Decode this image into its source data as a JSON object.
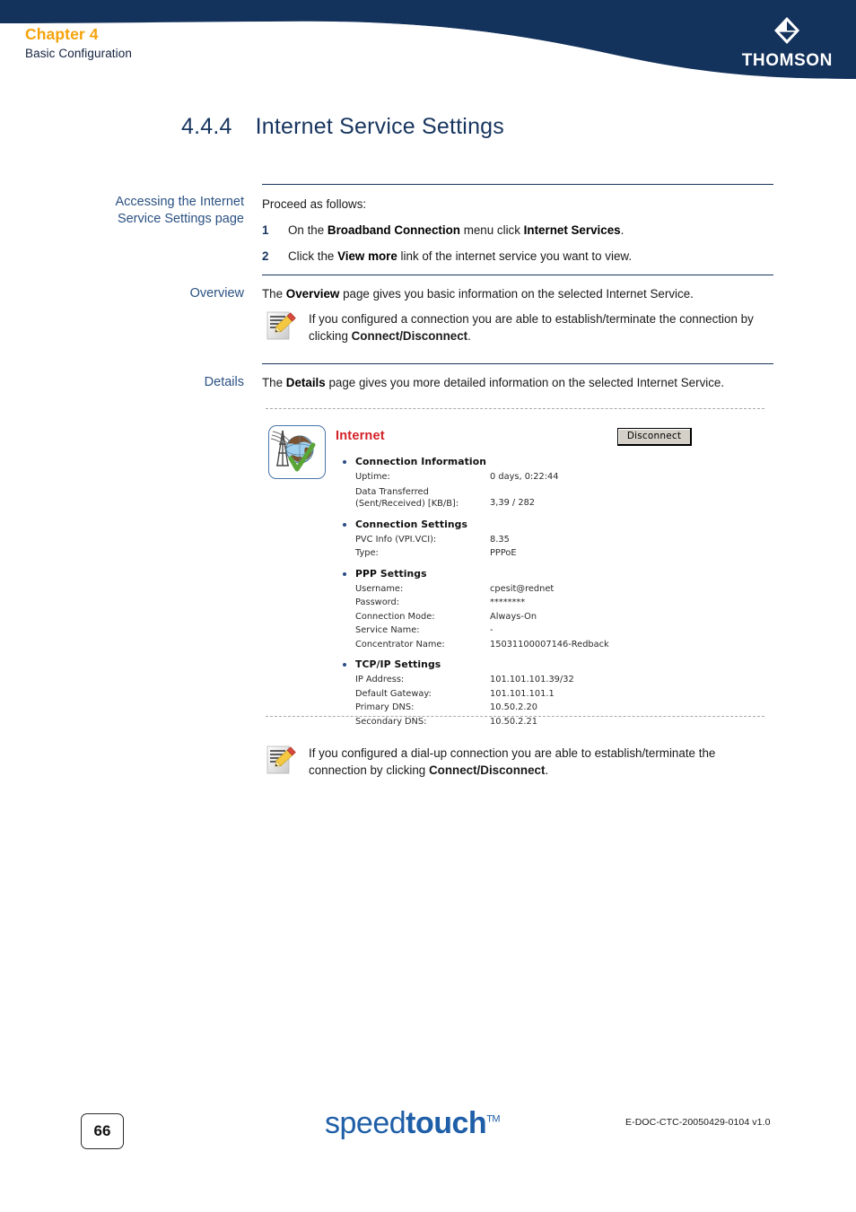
{
  "header": {
    "chapter": "Chapter 4",
    "subtitle": "Basic Configuration",
    "brand": "THOMSON",
    "brand_color": "#13325c",
    "chapter_color": "#f5a30a"
  },
  "section": {
    "number": "4.4.4",
    "title": "Internet Service Settings"
  },
  "blocks": {
    "accessing": {
      "side_label": "Accessing the Internet\nService Settings page",
      "intro": "Proceed as follows:",
      "steps": [
        {
          "num": "1",
          "html": "On the <b>Broadband Connection</b> menu click <b>Internet Services</b>."
        },
        {
          "num": "2",
          "html": "Click the <b>View more</b> link of the internet service you want to view."
        }
      ]
    },
    "overview": {
      "side_label": "Overview",
      "text_html": "The <b>Overview</b> page gives you basic information on the selected Internet Service.",
      "note_html": "If you configured a connection you are able to establish/terminate the connection by clicking <b>Connect/Disconnect</b>."
    },
    "details": {
      "side_label": "Details",
      "text_html": "The <b>Details</b> page gives you more detailed information on the selected Internet Service.",
      "note_html": "If you configured a dial-up connection you are able to establish/terminate the connection by clicking <b>Connect/Disconnect</b>."
    }
  },
  "screenshot": {
    "title": "Internet",
    "title_color": "#d42027",
    "button_label": "Disconnect",
    "icon_name": "internet-globe-antenna-check-icon",
    "groups": [
      {
        "heading": "Connection Information",
        "rows": [
          {
            "key": "Uptime:",
            "value": "0 days, 0:22:44"
          },
          {
            "key": "Data Transferred\n(Sent/Received) [KB/B]:",
            "value": "3,39 / 282"
          }
        ]
      },
      {
        "heading": "Connection Settings",
        "rows": [
          {
            "key": "PVC Info (VPI.VCI):",
            "value": "8.35"
          },
          {
            "key": "Type:",
            "value": "PPPoE"
          }
        ]
      },
      {
        "heading": "PPP Settings",
        "rows": [
          {
            "key": "Username:",
            "value": "cpesit@rednet"
          },
          {
            "key": "Password:",
            "value": "********"
          },
          {
            "key": "Connection Mode:",
            "value": "Always-On"
          },
          {
            "key": "Service Name:",
            "value": "-"
          },
          {
            "key": "Concentrator Name:",
            "value": "15031100007146-Redback"
          }
        ]
      },
      {
        "heading": "TCP/IP Settings",
        "rows": [
          {
            "key": "IP Address:",
            "value": "101.101.101.39/32"
          },
          {
            "key": "Default Gateway:",
            "value": "101.101.101.1"
          },
          {
            "key": "Primary DNS:",
            "value": "10.50.2.20"
          },
          {
            "key": "Secondary DNS:",
            "value": "10.50.2.21"
          }
        ]
      }
    ]
  },
  "footer": {
    "page_number": "66",
    "product_logo_light": "speed",
    "product_logo_heavy": "touch",
    "product_logo_tm": "TM",
    "doc_code": "E-DOC-CTC-20050429-0104 v1.0"
  }
}
